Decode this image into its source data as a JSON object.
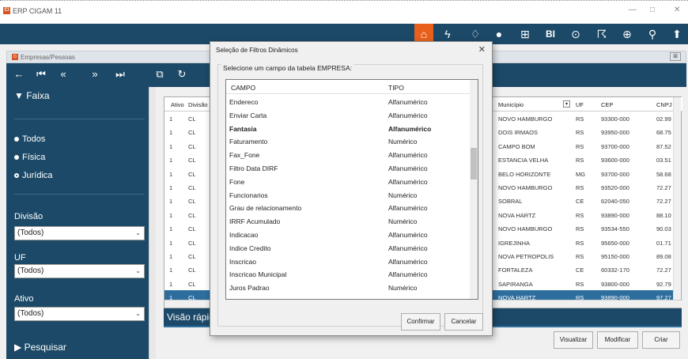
{
  "app": {
    "title": "ERP CIGAM 11",
    "logo_text": "Ci",
    "window_buttons": [
      "—",
      "□",
      "✕"
    ]
  },
  "topbar": {
    "icons": [
      "home-icon",
      "lightning-icon",
      "bell-icon",
      "chat-icon",
      "grid-icon",
      "bi-icon",
      "play-icon",
      "chart-icon",
      "globe-icon",
      "search-icon",
      "up-icon"
    ],
    "bi_text": "BI"
  },
  "window": {
    "title": "Empresas/Pessoas",
    "close": "⊠"
  },
  "sidebar": {
    "faixa": "▼ Faixa",
    "radios": [
      "Todos",
      "Física",
      "Jurídica"
    ],
    "divisao_label": "Divisão",
    "divisao_value": "(Todos)",
    "uf_label": "UF",
    "uf_value": "(Todos)",
    "ativo_label": "Ativo",
    "ativo_value": "(Todos)",
    "pesquisar": "▶ Pesquisar"
  },
  "grid": {
    "headers": {
      "ativo": "Ativo",
      "divisao": "Divisão",
      "municipio": "Município",
      "uf": "UF",
      "cep": "CEP",
      "cnpj": "CNPJ"
    },
    "rows": [
      {
        "ativo": "1",
        "divisao": "CL",
        "municipio": "NOVO HAMBURGO",
        "uf": "RS",
        "cep": "93300-000",
        "cnpj": "02.99"
      },
      {
        "ativo": "1",
        "divisao": "CL",
        "municipio": "DOIS IRMAOS",
        "uf": "RS",
        "cep": "93950-000",
        "cnpj": "68.75"
      },
      {
        "ativo": "1",
        "divisao": "CL",
        "municipio": "CAMPO BOM",
        "uf": "RS",
        "cep": "93700-000",
        "cnpj": "87.52"
      },
      {
        "ativo": "1",
        "divisao": "CL",
        "municipio": "ESTANCIA VELHA",
        "uf": "RS",
        "cep": "93600-000",
        "cnpj": "03.51"
      },
      {
        "ativo": "1",
        "divisao": "CL",
        "municipio": "BELO HORIZONTE",
        "uf": "MG",
        "cep": "93700-000",
        "cnpj": "58.68"
      },
      {
        "ativo": "1",
        "divisao": "CL",
        "municipio": "NOVO HAMBURGO",
        "uf": "RS",
        "cep": "93520-000",
        "cnpj": "72.27"
      },
      {
        "ativo": "1",
        "divisao": "CL",
        "municipio": "SOBRAL",
        "uf": "CE",
        "cep": "62040-050",
        "cnpj": "72.27"
      },
      {
        "ativo": "1",
        "divisao": "CL",
        "municipio": "NOVA HARTZ",
        "uf": "RS",
        "cep": "93890-000",
        "cnpj": "88.10"
      },
      {
        "ativo": "1",
        "divisao": "CL",
        "municipio": "NOVO HAMBURGO",
        "uf": "RS",
        "cep": "93534-550",
        "cnpj": "90.03"
      },
      {
        "ativo": "1",
        "divisao": "CL",
        "municipio": "IGREJINHA",
        "uf": "RS",
        "cep": "95650-000",
        "cnpj": "01.71"
      },
      {
        "ativo": "1",
        "divisao": "CL",
        "municipio": "NOVA PETROPOLIS",
        "uf": "RS",
        "cep": "95150-000",
        "cnpj": "89.08"
      },
      {
        "ativo": "1",
        "divisao": "CL",
        "municipio": "FORTALEZA",
        "uf": "CE",
        "cep": "60332-170",
        "cnpj": "72.27"
      },
      {
        "ativo": "1",
        "divisao": "CL",
        "municipio": "SAPIRANGA",
        "uf": "RS",
        "cep": "93800-000",
        "cnpj": "92.79"
      },
      {
        "ativo": "1",
        "divisao": "CL",
        "municipio": "NOVA HARTZ",
        "uf": "RS",
        "cep": "93890-000",
        "cnpj": "97.27"
      }
    ]
  },
  "visao": "Visão rápida",
  "buttons": {
    "visualizar": "Visualizar",
    "modificar": "Modificar",
    "criar": "Criar"
  },
  "dialog": {
    "title": "Seleção de Filtros Dinâmicos",
    "close": "✕",
    "group_label": "Selecione um campo da tabela EMPRESA:",
    "col_campo": "CAMPO",
    "col_tipo": "TIPO",
    "items": [
      {
        "campo": "Endereco",
        "tipo": "Alfanumérico"
      },
      {
        "campo": "Enviar Carta",
        "tipo": "Alfanumérico"
      },
      {
        "campo": "Fantasia",
        "tipo": "Alfanumérico"
      },
      {
        "campo": "Faturamento",
        "tipo": "Numérico"
      },
      {
        "campo": "Fax_Fone",
        "tipo": "Alfanumérico"
      },
      {
        "campo": "Filtro Data DIRF",
        "tipo": "Alfanumérico"
      },
      {
        "campo": "Fone",
        "tipo": "Alfanumérico"
      },
      {
        "campo": "Funcionarios",
        "tipo": "Numérico"
      },
      {
        "campo": "Grau de relacionamento",
        "tipo": "Alfanumérico"
      },
      {
        "campo": "IRRF Acumulado",
        "tipo": "Numérico"
      },
      {
        "campo": "Indicacao",
        "tipo": "Alfanumérico"
      },
      {
        "campo": "Indice Credito",
        "tipo": "Alfanumérico"
      },
      {
        "campo": "Inscricao",
        "tipo": "Alfanumérico"
      },
      {
        "campo": "Inscricao Municipal",
        "tipo": "Alfanumérico"
      },
      {
        "campo": "Juros Padrao",
        "tipo": "Numérico"
      }
    ],
    "confirmar": "Confirmar",
    "cancelar": "Cancelar"
  }
}
